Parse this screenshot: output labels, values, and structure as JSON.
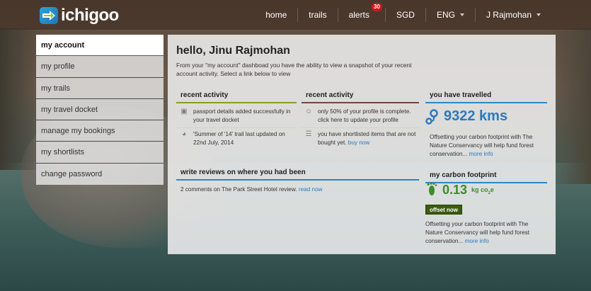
{
  "brand": {
    "name": "ichigoo",
    "accent": "#2ea1d9"
  },
  "nav": {
    "home": "home",
    "trails": "trails",
    "alerts": "alerts",
    "alerts_count": "30",
    "currency": "SGD",
    "language": "ENG",
    "user": "J Rajmohan"
  },
  "sidebar": {
    "items": [
      {
        "label": "my account",
        "active": true
      },
      {
        "label": "my profile"
      },
      {
        "label": "my trails"
      },
      {
        "label": "my travel docket"
      },
      {
        "label": "manage my bookings"
      },
      {
        "label": "my shortlists"
      },
      {
        "label": "change password"
      }
    ]
  },
  "main": {
    "greeting": "hello, Jinu Rajmohan",
    "intro": "From your \"my account\" dashboad you have the ability to view a snapshot of your recent account activity. Select a link below to view",
    "activity_left": {
      "title": "recent activity",
      "items": [
        {
          "icon": "passport-icon",
          "text": "passport details added successfully in your travel docket"
        },
        {
          "icon": "clock-icon",
          "text": "'Summer of '14' trail last updated on 22nd July, 2014"
        }
      ]
    },
    "activity_right": {
      "title": "recent activity",
      "items": [
        {
          "icon": "user-icon",
          "text": "only 50% of your profile is complete. click here to update your profile"
        },
        {
          "icon": "list-icon",
          "text": "you have shortlisted items that are not bought yet.",
          "link": "buy now"
        }
      ]
    },
    "reviews": {
      "title": "write reviews on where you had been",
      "text": "2 comments on The Park Street Hotel review.",
      "link": "read now"
    },
    "travelled": {
      "title": "you have travelled",
      "value": "9322 kms",
      "note": "Offsetting your carbon footprint with The Nature Conservancy will help fund forest conservation...",
      "link": "more info"
    },
    "carbon": {
      "title": "my carbon footprint",
      "value": "0.13",
      "unit_prefix": "kg co",
      "unit_sub": "2",
      "unit_suffix": "e",
      "button": "offset now",
      "note": "Offsetting your carbon footprint with The Nature Conservancy will help fund forest conservation...",
      "link": "more info"
    }
  },
  "colors": {
    "green": "#7da12b",
    "brown": "#6b4a37",
    "blue": "#2c86c6",
    "link": "#2a79c0",
    "alert_badge": "#d0161b"
  }
}
